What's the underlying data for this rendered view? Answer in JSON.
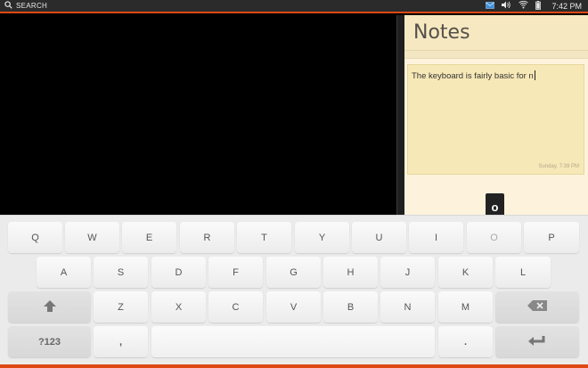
{
  "status_bar": {
    "search_label": "SEARCH",
    "time": "7:42 PM",
    "icons": [
      "search-icon",
      "mail-icon",
      "volume-icon",
      "wifi-icon",
      "battery-icon"
    ],
    "accent_color": "#dd4814"
  },
  "notes": {
    "title": "Notes",
    "note_text": "The keyboard is fairly basic for n",
    "note_date": "Sunday, 7:39 PM"
  },
  "key_preview": "o",
  "keyboard": {
    "row1": [
      "Q",
      "W",
      "E",
      "R",
      "T",
      "Y",
      "U",
      "I",
      "O",
      "P"
    ],
    "row2": [
      "A",
      "S",
      "D",
      "F",
      "G",
      "H",
      "J",
      "K",
      "L"
    ],
    "row3": [
      "Z",
      "X",
      "C",
      "V",
      "B",
      "N",
      "M"
    ],
    "numbers_label": "?123",
    "comma": ",",
    "period": ".",
    "shift_icon": "shift-arrow-icon",
    "backspace_icon": "backspace-icon",
    "enter_icon": "enter-icon"
  }
}
